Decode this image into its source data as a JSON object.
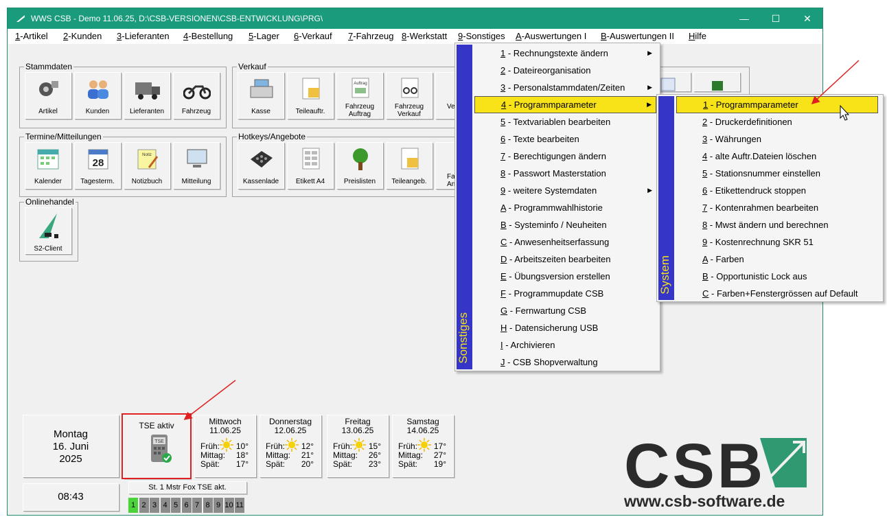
{
  "window": {
    "title": "WWS CSB - Demo  11.06.25, D:\\CSB-VERSIONEN\\CSB-ENTWICKLUNG\\PRG\\"
  },
  "menubar": [
    {
      "key": "1",
      "rest": "-Artikel"
    },
    {
      "key": "2",
      "rest": "-Kunden"
    },
    {
      "key": "3",
      "rest": "-Lieferanten"
    },
    {
      "key": "4",
      "rest": "-Bestellung"
    },
    {
      "key": "5",
      "rest": "-Lager"
    },
    {
      "key": "6",
      "rest": "-Verkauf"
    },
    {
      "key": "7",
      "rest": "-Fahrzeug"
    },
    {
      "key": "8",
      "rest": "-Werkstatt"
    },
    {
      "key": "9",
      "rest": "-Sonstiges"
    },
    {
      "key": "A",
      "rest": "-Auswertungen I"
    },
    {
      "key": "B",
      "rest": "-Auswertungen II"
    },
    {
      "key": "H",
      "rest": "ilfe"
    }
  ],
  "groups": {
    "stammdaten": {
      "label": "Stammdaten",
      "tiles": [
        "Artikel",
        "Kunden",
        "Lieferanten",
        "Fahrzeug"
      ]
    },
    "verkauf": {
      "label": "Verkauf",
      "tiles": [
        "Kasse",
        "Teileauftr.",
        "Fahrzeug\nAuftrag",
        "Fahrzeug\nVerkauf",
        "Ve"
      ]
    },
    "termine": {
      "label": "Termine/Mitteilungen",
      "tiles": [
        "Kalender",
        "Tagesterm.",
        "Notizbuch",
        "Mitteilung"
      ]
    },
    "hotkeys": {
      "label": "Hotkeys/Angebote",
      "tiles": [
        "Kassenlade",
        "Etikett A4",
        "Preislisten",
        "Teileangeb.",
        "Fah\nAn"
      ]
    },
    "online": {
      "label": "Onlinehandel",
      "tiles": [
        "S2-Client"
      ]
    }
  },
  "icon_texts": {
    "auftrag": "Auftrag",
    "notiz": "Notiz",
    "kalender_day": "28",
    "tse": "TSE"
  },
  "sonstiges_menu": {
    "band": "Sonstiges",
    "items": [
      {
        "key": "1",
        "text": " - Rechnungstexte ändern",
        "sub": true
      },
      {
        "key": "2",
        "text": " - Dateireorganisation",
        "sub": false
      },
      {
        "key": "3",
        "text": " - Personalstammdaten/Zeiten",
        "sub": true
      },
      {
        "key": "4",
        "text": " - Programmparameter",
        "sub": true,
        "selected": true
      },
      {
        "key": "5",
        "text": " - Textvariablen bearbeiten",
        "sub": false
      },
      {
        "key": "6",
        "text": " - Texte bearbeiten",
        "sub": false
      },
      {
        "key": "7",
        "text": " - Berechtigungen ändern",
        "sub": false
      },
      {
        "key": "8",
        "text": " - Passwort Masterstation",
        "sub": false
      },
      {
        "key": "9",
        "text": " - weitere Systemdaten",
        "sub": true
      },
      {
        "key": "A",
        "text": " - Programmwahlhistorie",
        "sub": false
      },
      {
        "key": "B",
        "text": " - Systeminfo / Neuheiten",
        "sub": false
      },
      {
        "key": "C",
        "text": " - Anwesenheitserfassung",
        "sub": false
      },
      {
        "key": "D",
        "text": " - Arbeitszeiten bearbeiten",
        "sub": false
      },
      {
        "key": "E",
        "text": " - Übungsversion erstellen",
        "sub": false
      },
      {
        "key": "F",
        "text": " - Programmupdate CSB",
        "sub": false
      },
      {
        "key": "G",
        "text": " - Fernwartung CSB",
        "sub": false
      },
      {
        "key": "H",
        "text": " - Datensicherung USB",
        "sub": false
      },
      {
        "key": "I",
        "text": " - Archivieren",
        "sub": false
      },
      {
        "key": "J",
        "text": " - CSB Shopverwaltung",
        "sub": false
      }
    ]
  },
  "system_menu": {
    "band": "System",
    "items": [
      {
        "key": "1",
        "text": " - Programmparameter",
        "selected": true
      },
      {
        "key": "2",
        "text": " - Druckerdefinitionen"
      },
      {
        "key": "3",
        "text": " - Währungen"
      },
      {
        "key": "4",
        "text": " - alte Auftr.Dateien löschen"
      },
      {
        "key": "5",
        "text": " - Stationsnummer einstellen"
      },
      {
        "key": "6",
        "text": " - Etikettendruck stoppen"
      },
      {
        "key": "7",
        "text": " - Kontenrahmen bearbeiten"
      },
      {
        "key": "8",
        "text": " - Mwst ändern und berechnen"
      },
      {
        "key": "9",
        "text": " - Kostenrechnung SKR 51"
      },
      {
        "key": "A",
        "text": " - Farben"
      },
      {
        "key": "B",
        "text": " - Opportunistic Lock aus"
      },
      {
        "key": "C",
        "text": " - Farben+Fenstergrössen auf Default"
      }
    ]
  },
  "today": {
    "weekday": "Montag",
    "date": "16. Juni",
    "year": "2025",
    "time": "08:43"
  },
  "tse": {
    "label": "TSE aktiv",
    "status": "St. 1 Mstr Fox TSE akt."
  },
  "forecast": [
    {
      "day": "Mittwoch",
      "date": "11.06.25",
      "frueh": "10°",
      "mittag": "18°",
      "spaet": "17°"
    },
    {
      "day": "Donnerstag",
      "date": "12.06.25",
      "frueh": "12°",
      "mittag": "21°",
      "spaet": "20°"
    },
    {
      "day": "Freitag",
      "date": "13.06.25",
      "frueh": "15°",
      "mittag": "26°",
      "spaet": "23°"
    },
    {
      "day": "Samstag",
      "date": "14.06.25",
      "frueh": "17°",
      "mittag": "27°",
      "spaet": "19°"
    }
  ],
  "forecast_labels": {
    "frueh": "Früh:",
    "mittag": "Mittag:",
    "spaet": "Spät:"
  },
  "stations": [
    "1",
    "2",
    "3",
    "4",
    "5",
    "6",
    "7",
    "8",
    "9",
    "10",
    "11"
  ],
  "active_station": "1",
  "logo": {
    "text": "CSB",
    "url": "www.csb-software.de"
  },
  "colors": {
    "titlebar": "#1a9b7b",
    "menu_band": "#3535c8",
    "band_text": "#f5e21a",
    "highlight": "#f7e317",
    "annotation": "#e02020",
    "led_on": "#4ad43a"
  }
}
